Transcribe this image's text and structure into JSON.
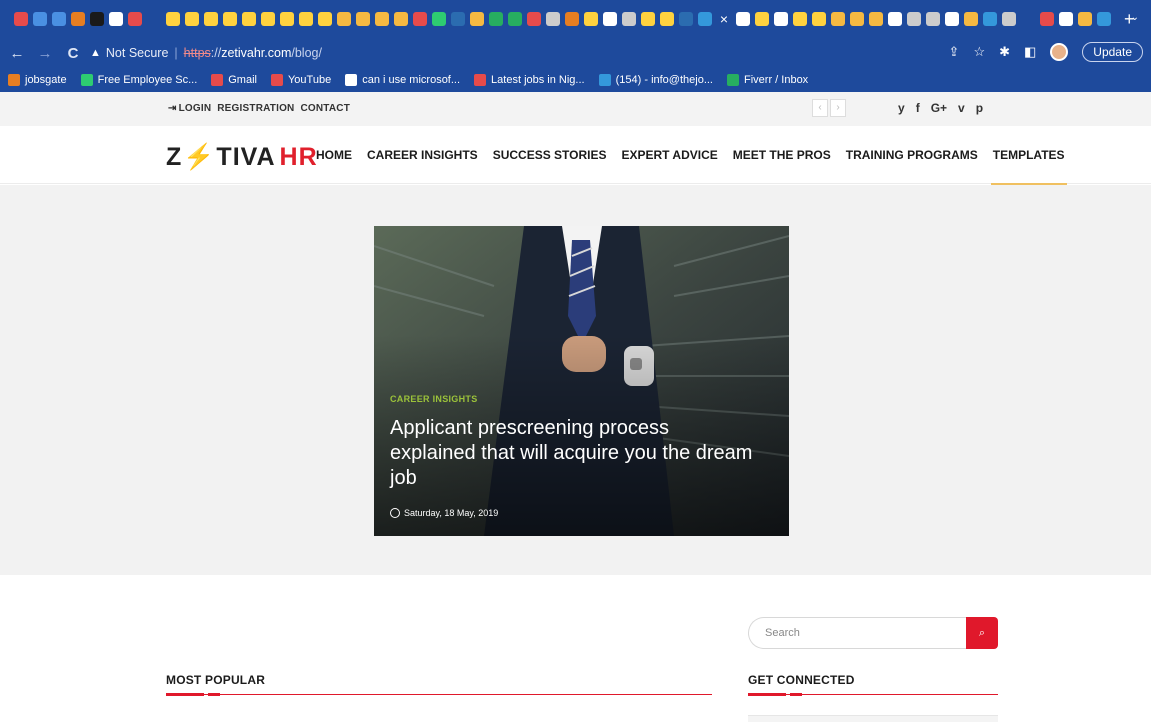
{
  "browser": {
    "tab_favicons": [
      "#e64b4b",
      "#4a90e2",
      "#4a90e2",
      "#e67e22",
      "#1a1a1a",
      "#ffffff",
      "#e64b4b",
      "#1e4a9c",
      "#ffd23f",
      "#ffd23f",
      "#ffd23f",
      "#ffd23f",
      "#ffd23f",
      "#ffd23f",
      "#ffd23f",
      "#ffd23f",
      "#ffd23f",
      "#f5b942",
      "#f5b942",
      "#f5b942",
      "#f5b942",
      "#e64b4b",
      "#2ecc71",
      "#2b6cb0",
      "#f5b942",
      "#27ae60",
      "#27ae60",
      "#e64b4b",
      "#cccccc",
      "#e67e22",
      "#ffd23f",
      "#ffffff",
      "#cccccc",
      "#ffd23f",
      "#ffd23f",
      "#2b6cb0",
      "#3498db"
    ],
    "active_tab_close": "×",
    "tab_favicons_right": [
      "#ffffff",
      "#ffd23f",
      "#ffffff",
      "#ffd23f",
      "#ffd23f",
      "#f5b942",
      "#f5b942",
      "#f5b942",
      "#ffffff",
      "#cccccc",
      "#cccccc",
      "#ffffff",
      "#f5b942",
      "#3498db",
      "#cccccc",
      "#1e4a9c",
      "#e64b4b",
      "#ffffff",
      "#f5b942",
      "#3498db"
    ],
    "new_tab": "+",
    "tab_menu": "⌄",
    "back": "←",
    "forward": "→",
    "reload": "C",
    "security_warning": "Not Secure",
    "url_scheme": "https",
    "url_scheme_sep": "://",
    "url_host": "zetivahr.com",
    "url_path": "/blog/",
    "update_label": "Update",
    "bookmarks": [
      {
        "label": "jobsgate",
        "color": "#e67e22"
      },
      {
        "label": "Free Employee Sc...",
        "color": "#2ecc71"
      },
      {
        "label": "Gmail",
        "color": "#e64b4b"
      },
      {
        "label": "YouTube",
        "color": "#e64b4b"
      },
      {
        "label": "can i use microsof...",
        "color": "#ffffff"
      },
      {
        "label": "Latest jobs in Nig...",
        "color": "#e64b4b"
      },
      {
        "label": "(154) - info@thejo...",
        "color": "#3498db"
      },
      {
        "label": "Fiverr / Inbox",
        "color": "#27ae60"
      }
    ]
  },
  "topbar": {
    "login": "LOGIN",
    "registration": "REGISTRATION",
    "contact": "CONTACT",
    "prev": "‹",
    "next": "›",
    "social": [
      "y",
      "f",
      "G+",
      "v",
      "p"
    ]
  },
  "nav": {
    "logo_z": "Z",
    "logo_bolt": "⚡",
    "logo_rest": "TIVA",
    "logo_hr": "HR",
    "items": [
      "HOME",
      "CAREER INSIGHTS",
      "SUCCESS STORIES",
      "EXPERT ADVICE",
      "MEET THE PROS",
      "TRAINING PROGRAMS",
      "TEMPLATES"
    ]
  },
  "feature": {
    "category": "CAREER INSIGHTS",
    "title": "Applicant prescreening process explained that will acquire you the dream job",
    "date": "Saturday, 18 May, 2019"
  },
  "sidebar": {
    "search_placeholder": "Search",
    "search_icon": "search-icon",
    "get_connected": "GET CONNECTED"
  },
  "main": {
    "most_popular": "MOST POPULAR"
  }
}
